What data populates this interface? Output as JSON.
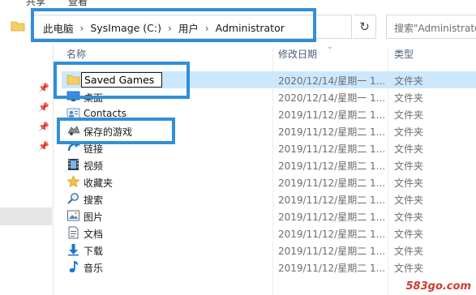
{
  "ribbon": {
    "share_label": "共享",
    "view_label": "查看"
  },
  "address": {
    "crumbs": [
      "此电脑",
      "SysImage (C:)",
      "用户",
      "Administrator"
    ],
    "search_placeholder": "搜索\"Administrator\""
  },
  "columns": {
    "name": "名称",
    "modified": "修改日期",
    "type": "类型"
  },
  "rename_value": "Saved Games",
  "items": [
    {
      "name": "",
      "date": "2020/12/14/星期一 1...",
      "type": "文件夹",
      "icon": "folder-icon"
    },
    {
      "name": "桌面",
      "date": "2020/12/14/星期一 1...",
      "type": "文件夹",
      "icon": "desktop-icon"
    },
    {
      "name": "Contacts",
      "date": "2019/11/12/星期二 1...",
      "type": "文件夹",
      "icon": "contacts-icon"
    },
    {
      "name": "保存的游戏",
      "date": "2019/11/12/星期二 1...",
      "type": "文件夹",
      "icon": "saved-games-icon"
    },
    {
      "name": "链接",
      "date": "2019/11/12/星期二 1...",
      "type": "文件夹",
      "icon": "links-icon"
    },
    {
      "name": "视频",
      "date": "2019/11/12/星期二 1...",
      "type": "文件夹",
      "icon": "videos-icon"
    },
    {
      "name": "收藏夹",
      "date": "2019/11/12/星期二 1...",
      "type": "文件夹",
      "icon": "favorites-icon"
    },
    {
      "name": "搜索",
      "date": "2019/11/12/星期二 1...",
      "type": "文件夹",
      "icon": "searches-icon"
    },
    {
      "name": "图片",
      "date": "2019/11/12/星期二 1...",
      "type": "文件夹",
      "icon": "pictures-icon"
    },
    {
      "name": "文档",
      "date": "2019/11/12/星期二 1...",
      "type": "文件夹",
      "icon": "documents-icon"
    },
    {
      "name": "下载",
      "date": "2019/11/12/星期二 1...",
      "type": "文件夹",
      "icon": "downloads-icon"
    },
    {
      "name": "音乐",
      "date": "2019/11/12/星期二 1...",
      "type": "文件夹",
      "icon": "music-icon"
    }
  ],
  "watermark": "583go.com",
  "colors": {
    "selection": "#cce8ff",
    "annotation": "#2f8fdb",
    "folder": "#f5cf63"
  }
}
